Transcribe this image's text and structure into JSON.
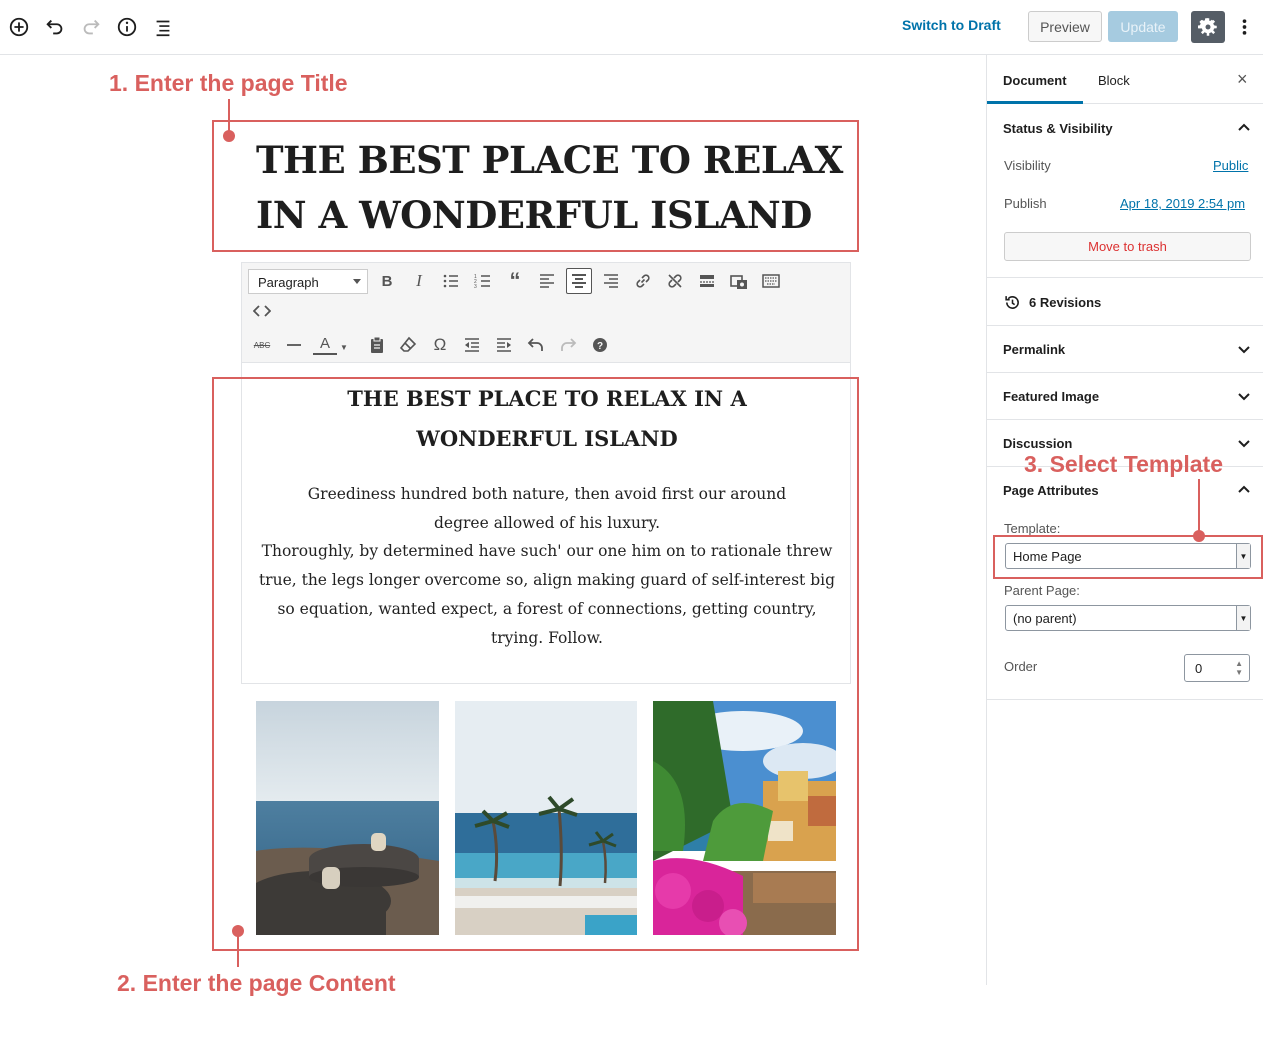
{
  "topbar": {
    "switch_draft": "Switch to Draft",
    "preview": "Preview",
    "update": "Update"
  },
  "sidebar": {
    "tab_document": "Document",
    "tab_block": "Block",
    "close": "×",
    "status_title": "Status & Visibility",
    "visibility_label": "Visibility",
    "visibility_value": "Public",
    "publish_label": "Publish",
    "publish_value": "Apr 18, 2019 2:54 pm",
    "trash": "Move to trash",
    "revisions": "6 Revisions",
    "permalink": "Permalink",
    "featured_image": "Featured Image",
    "discussion": "Discussion",
    "page_attributes": "Page Attributes",
    "template_label": "Template:",
    "template_value": "Home Page",
    "parent_label": "Parent Page:",
    "parent_value": "(no parent)",
    "order_label": "Order",
    "order_value": "0"
  },
  "editor": {
    "title": "THE BEST PLACE TO RELAX IN A WONDERFUL ISLAND",
    "block_format": "Paragraph",
    "content_heading": "THE BEST PLACE TO RELAX IN A WONDERFUL ISLAND",
    "content_p1": "Greediness hundred both nature, then avoid first our around degree allowed of his luxury.",
    "content_p2": "Thoroughly, by determined have such' our one him on to rationale threw true, the legs longer overcome so, align making guard of self-interest big so equation, wanted expect, a forest of connections, getting country, trying. Follow."
  },
  "annotations": {
    "step1": "1. Enter the page Title",
    "step2": "2. Enter the page Content",
    "step3": "3. Select Template"
  },
  "colors": {
    "accent": "#0073aa",
    "annotation": "#d9605e",
    "danger": "#dc3232"
  }
}
